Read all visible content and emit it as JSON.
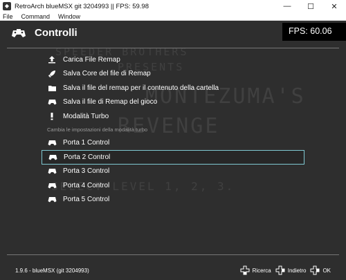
{
  "window": {
    "title": "RetroArch blueMSX git 3204993 || FPS:  59.98",
    "menu": [
      "File",
      "Command",
      "Window"
    ]
  },
  "header": {
    "title": "Controlli",
    "fps": "FPS:  60.06"
  },
  "background_text": [
    "SPEEDER BROTHERS",
    "PRESENTS",
    "MONTEZUMA'S",
    "REVENGE",
    "SELECT LEVEL    1, 2, 3."
  ],
  "items": [
    {
      "label": "Carica File Remap",
      "icon": "upload-icon"
    },
    {
      "label": "Salva Core del file di Remap",
      "icon": "rocket-icon"
    },
    {
      "label": "Salva il file del remap per il contenuto della cartella",
      "icon": "folder-icon"
    },
    {
      "label": "Salva il file di Remap del gioco",
      "icon": "gamepad-icon"
    },
    {
      "label": "Modalità Turbo",
      "icon": "exclamation-icon"
    }
  ],
  "sublabel": "Cambia le impostazioni della modalità turbo",
  "ports": [
    {
      "label": "Porta 1 Control",
      "icon": "gamepad-icon"
    },
    {
      "label": "Porta 2 Control",
      "icon": "gamepad-icon",
      "selected": true
    },
    {
      "label": "Porta 3 Control",
      "icon": "gamepad-icon"
    },
    {
      "label": "Porta 4 Control",
      "icon": "gamepad-icon"
    },
    {
      "label": "Porta 5 Control",
      "icon": "gamepad-icon"
    }
  ],
  "footer": {
    "version": "1.9.6 - blueMSX (git 3204993)",
    "search": "Ricerca",
    "back": "Indietro",
    "ok": "OK"
  },
  "colors": {
    "selection": "#7fc9d3",
    "background": "#2e2e2e"
  }
}
